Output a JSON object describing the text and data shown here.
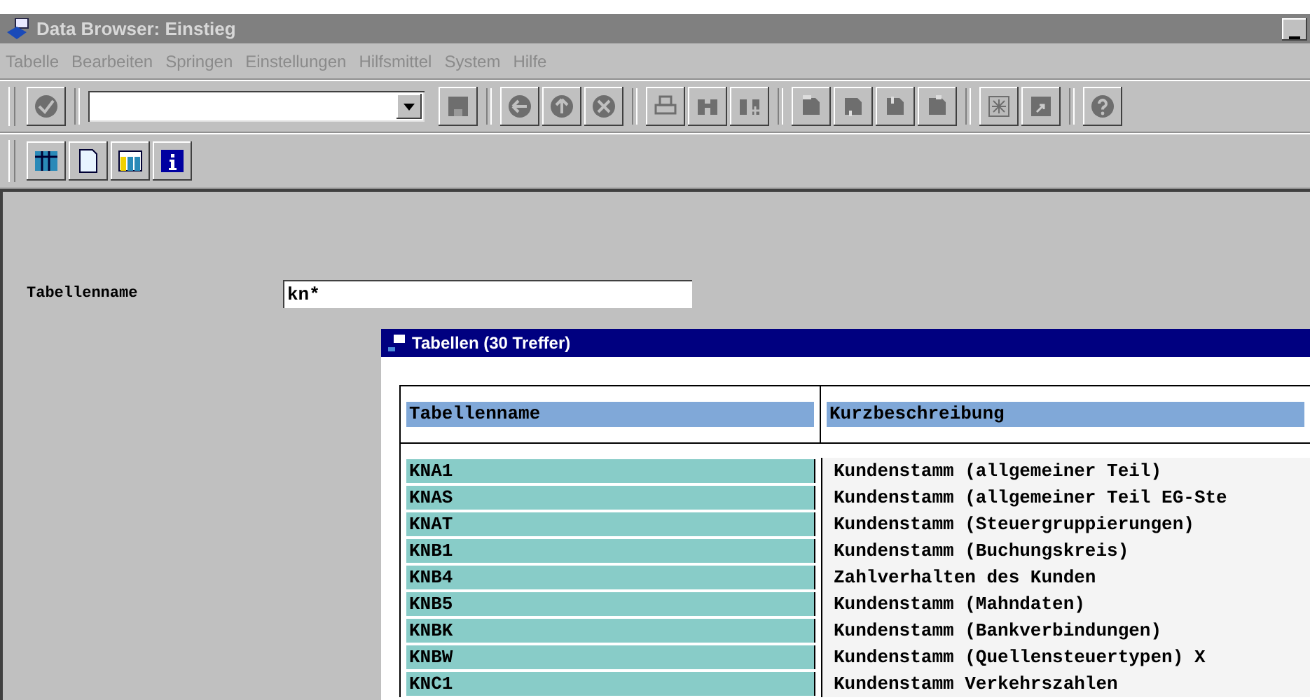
{
  "window": {
    "title": "Data Browser: Einstieg"
  },
  "menu": [
    "Tabelle",
    "Bearbeiten",
    "Springen",
    "Einstellungen",
    "Hilfsmittel",
    "System",
    "Hilfe"
  ],
  "form": {
    "label": "Tabellenname",
    "value": "kn*"
  },
  "dialog": {
    "title": "Tabellen (30 Treffer)",
    "columns": [
      "Tabellenname",
      "Kurzbeschreibung"
    ],
    "rows": [
      {
        "name": "KNA1",
        "description": "Kundenstamm (allgemeiner Teil)"
      },
      {
        "name": "KNAS",
        "description": "Kundenstamm (allgemeiner Teil EG-Ste"
      },
      {
        "name": "KNAT",
        "description": "Kundenstamm (Steuergruppierungen)"
      },
      {
        "name": "KNB1",
        "description": "Kundenstamm (Buchungskreis)"
      },
      {
        "name": "KNB4",
        "description": "Zahlverhalten des Kunden"
      },
      {
        "name": "KNB5",
        "description": "Kundenstamm (Mahndaten)"
      },
      {
        "name": "KNBK",
        "description": "Kundenstamm (Bankverbindungen)"
      },
      {
        "name": "KNBW",
        "description": "Kundenstamm (Quellensteuertypen) X"
      },
      {
        "name": "KNC1",
        "description": "Kundenstamm Verkehrszahlen"
      }
    ]
  }
}
